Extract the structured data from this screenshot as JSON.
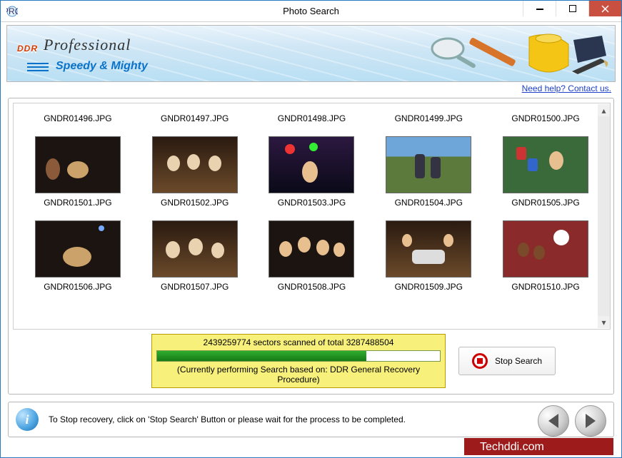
{
  "window": {
    "title": "Photo Search"
  },
  "logo": {
    "brand": "DDR",
    "product": "Professional",
    "tagline": "Speedy & Mighty"
  },
  "help": {
    "link": "Need help? Contact us."
  },
  "files": {
    "row0": [
      "GNDR01496.JPG",
      "GNDR01497.JPG",
      "GNDR01498.JPG",
      "GNDR01499.JPG",
      "GNDR01500.JPG"
    ],
    "row1": [
      "GNDR01501.JPG",
      "GNDR01502.JPG",
      "GNDR01503.JPG",
      "GNDR01504.JPG",
      "GNDR01505.JPG"
    ],
    "row2": [
      "GNDR01506.JPG",
      "GNDR01507.JPG",
      "GNDR01508.JPG",
      "GNDR01509.JPG",
      "GNDR01510.JPG"
    ]
  },
  "progress": {
    "sectors_scanned": "2439259774",
    "sectors_total": "3287488504",
    "percent": 74,
    "line1": "2439259774 sectors scanned of total 3287488504",
    "line2": "(Currently performing Search based on:  DDR General Recovery Procedure)"
  },
  "buttons": {
    "stop": "Stop Search"
  },
  "footer": {
    "hint": "To Stop recovery, click on 'Stop Search' Button or please wait for the process to be completed."
  },
  "watermark": "Techddi.com"
}
